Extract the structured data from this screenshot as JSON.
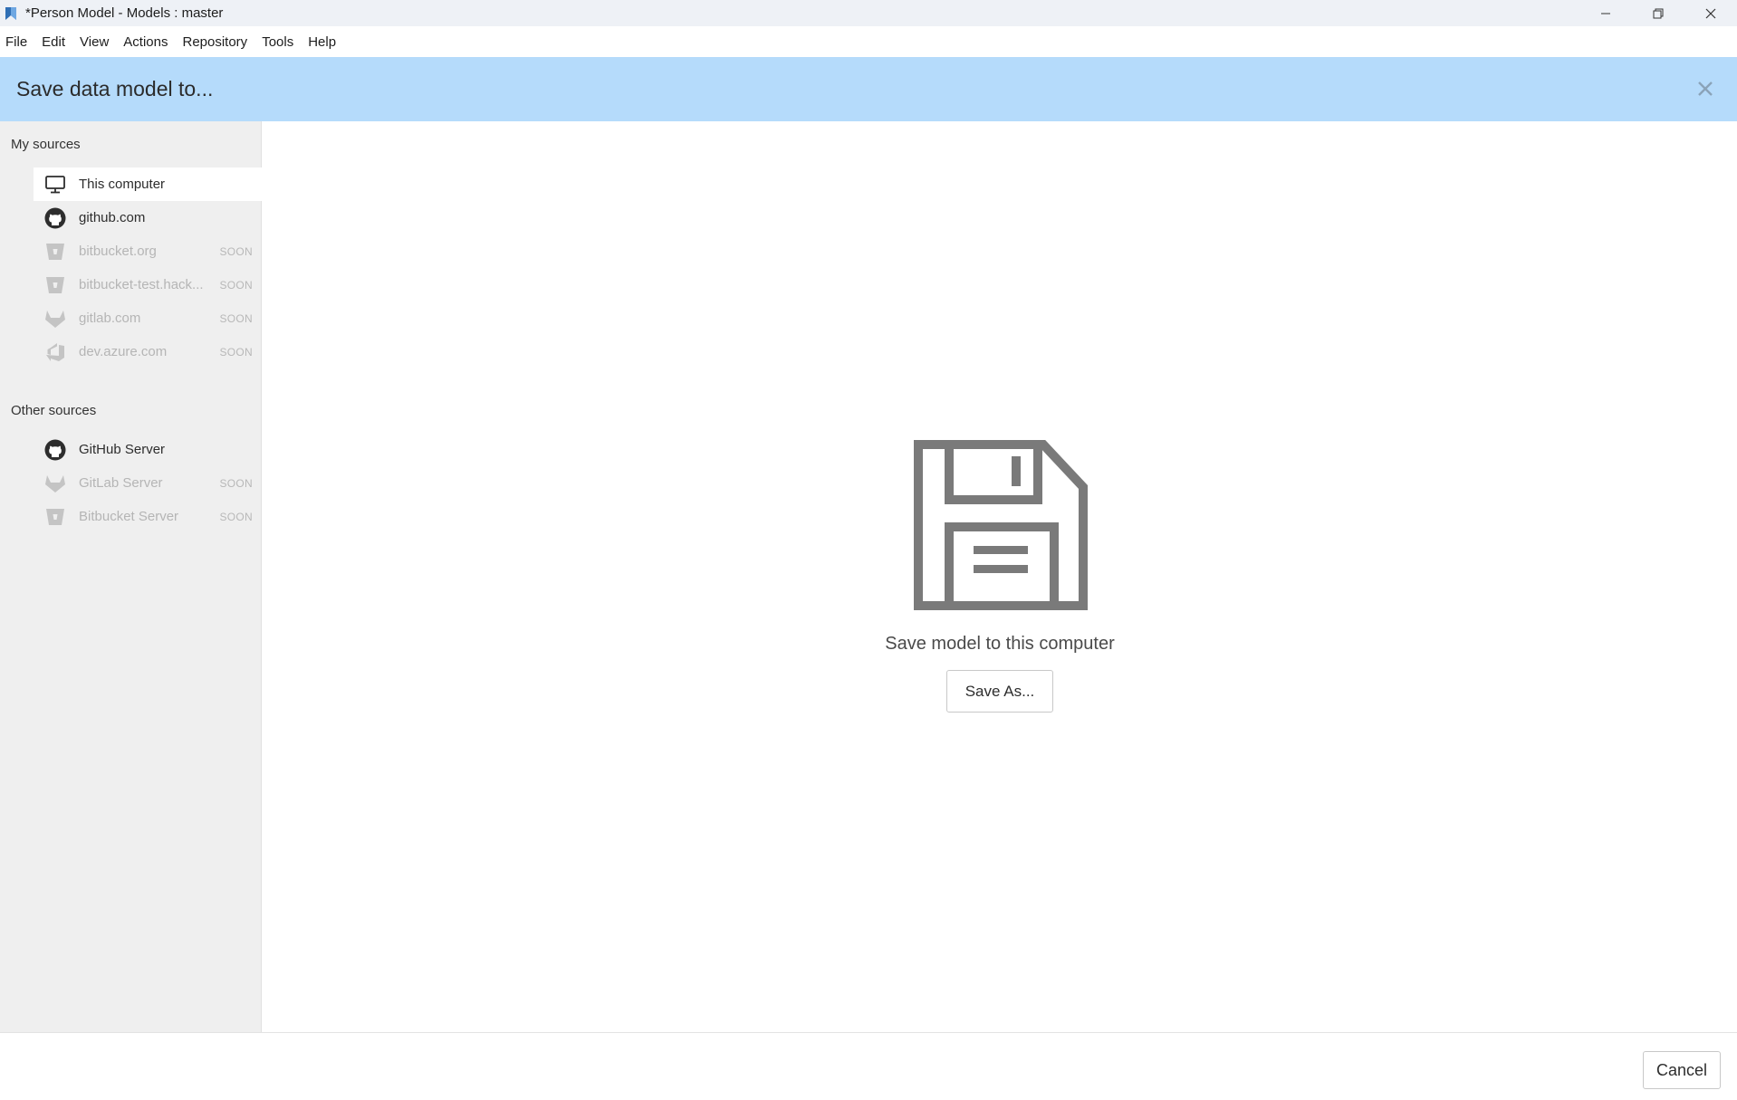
{
  "window": {
    "title": "*Person Model - Models : master"
  },
  "menu": [
    "File",
    "Edit",
    "View",
    "Actions",
    "Repository",
    "Tools",
    "Help"
  ],
  "dialog": {
    "title": "Save data model to...",
    "my_sources_title": "My sources",
    "other_sources_title": "Other sources",
    "my_sources": [
      {
        "label": "This computer",
        "icon": "monitor-icon",
        "active": true,
        "soon": ""
      },
      {
        "label": "github.com",
        "icon": "github-icon",
        "active": false,
        "soon": ""
      },
      {
        "label": "bitbucket.org",
        "icon": "bitbucket-icon",
        "active": false,
        "soon": "SOON"
      },
      {
        "label": "bitbucket-test.hack...",
        "icon": "bitbucket-icon",
        "active": false,
        "soon": "SOON"
      },
      {
        "label": "gitlab.com",
        "icon": "gitlab-icon",
        "active": false,
        "soon": "SOON"
      },
      {
        "label": "dev.azure.com",
        "icon": "azure-devops-icon",
        "active": false,
        "soon": "SOON"
      }
    ],
    "other_sources": [
      {
        "label": "GitHub Server",
        "icon": "github-icon",
        "soon": ""
      },
      {
        "label": "GitLab Server",
        "icon": "gitlab-icon",
        "soon": "SOON"
      },
      {
        "label": "Bitbucket Server",
        "icon": "bitbucket-icon",
        "soon": "SOON"
      }
    ],
    "main": {
      "caption": "Save model to this computer",
      "save_as_label": "Save As..."
    },
    "cancel_label": "Cancel"
  },
  "colors": {
    "header_bg": "#b5dbfb",
    "sidebar_bg": "#efefef",
    "floppy": "#7a7a7a"
  }
}
